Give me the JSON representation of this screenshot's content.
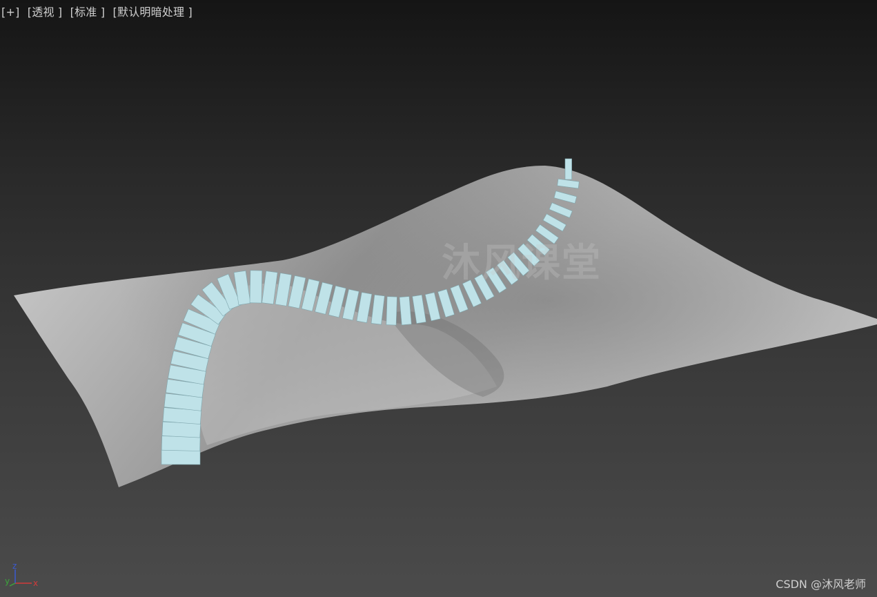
{
  "viewport": {
    "labels": [
      "[+]",
      "[透视 ]",
      "[标准 ]",
      "[默认明暗处理 ]"
    ],
    "watermark": "沐风课堂",
    "credit": "CSDN @沐风老师",
    "axes": {
      "x": "x",
      "y": "y",
      "z": "z"
    },
    "colors": {
      "surface": "#b9b9b9",
      "tiles": "#bfe2e8",
      "axis_x": "#d23a3a",
      "axis_y": "#3ba53b",
      "axis_z": "#3b5bd2"
    }
  }
}
